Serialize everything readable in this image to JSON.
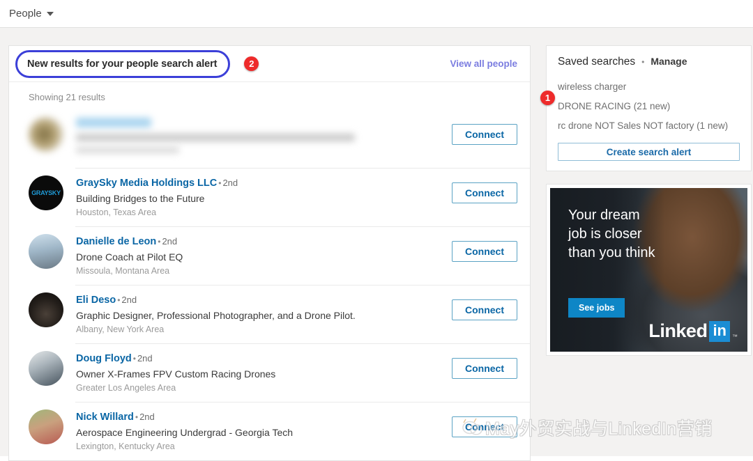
{
  "topbar": {
    "filter_label": "People",
    "caret_icon": "chevron-down-icon"
  },
  "results_card": {
    "alert_title": "New results for your people search alert",
    "annotation_badge": "2",
    "view_all_label": "View all people",
    "showing_results": "Showing 21 results",
    "connect_label": "Connect",
    "people": [
      {
        "name": "",
        "degree": "",
        "headline": "",
        "location": "",
        "redacted": true
      },
      {
        "name": "GraySky Media Holdings LLC",
        "degree": "2nd",
        "headline": "Building Bridges to the Future",
        "location": "Houston, Texas Area",
        "redacted": false
      },
      {
        "name": "Danielle de Leon",
        "degree": "2nd",
        "headline": "Drone Coach at Pilot EQ",
        "location": "Missoula, Montana Area",
        "redacted": false
      },
      {
        "name": "Eli Deso",
        "degree": "2nd",
        "headline": "Graphic Designer, Professional Photographer, and a Drone Pilot.",
        "location": "Albany, New York Area",
        "redacted": false
      },
      {
        "name": "Doug Floyd",
        "degree": "2nd",
        "headline": "Owner X-Frames FPV Custom Racing Drones",
        "location": "Greater Los Angeles Area",
        "redacted": false
      },
      {
        "name": "Nick Willard",
        "degree": "2nd",
        "headline": "Aerospace Engineering Undergrad - Georgia Tech",
        "location": "Lexington, Kentucky Area",
        "redacted": false
      }
    ]
  },
  "saved_searches": {
    "title": "Saved searches",
    "separator": "•",
    "manage_label": "Manage",
    "annotation_badge": "1",
    "items": [
      "wireless charger",
      "DRONE RACING (21 new)",
      "rc drone NOT Sales NOT factory (1 new)"
    ],
    "create_alert_label": "Create search alert"
  },
  "ad": {
    "headline": "Your dream job is closer than you think",
    "cta_label": "See jobs",
    "brand_word": "Linked",
    "brand_box": "in",
    "brand_tm": "™"
  },
  "watermark": {
    "text": "May外贸实战与LinkedIn营销",
    "icon": "wechat-mascot-icon"
  },
  "colors": {
    "page_background": "#f3f2f1",
    "card_background": "#ffffff",
    "link_blue": "#0a66a5",
    "view_all_purple": "#7b7de0",
    "annotation_red": "#ee2b2b",
    "annotation_blue": "#3b3fd8",
    "ad_cta_blue": "#0e86c6"
  }
}
